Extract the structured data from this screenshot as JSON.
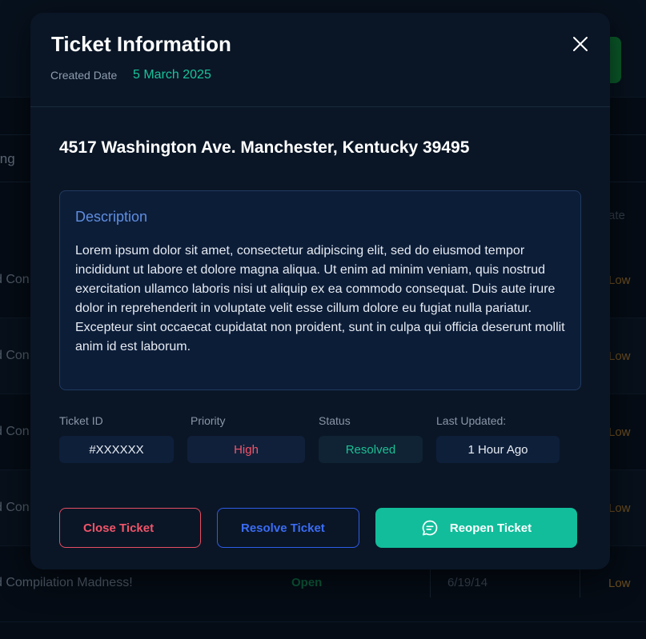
{
  "background": {
    "column_header": "ing",
    "date_header": "ate",
    "rows": [
      {
        "title": "d Con",
        "priority": "Low"
      },
      {
        "title": "d Con",
        "priority": "Low"
      },
      {
        "title": "d Con",
        "priority": "Low"
      },
      {
        "title": "d Con",
        "priority": "Low"
      },
      {
        "title": "d Compilation Madness!",
        "status": "Open",
        "date": "6/19/14",
        "priority": "Low"
      }
    ]
  },
  "modal": {
    "title": "Ticket Information",
    "created_label": "Created Date",
    "created_date": "5 March 2025",
    "close_icon": "close-icon",
    "address": "4517 Washington Ave. Manchester, Kentucky 39495",
    "description": {
      "title": "Description",
      "body": "Lorem ipsum dolor sit amet, consectetur adipiscing elit, sed do eiusmod tempor incididunt ut labore et dolore magna aliqua. Ut enim ad minim veniam, quis nostrud exercitation ullamco laboris nisi ut aliquip ex ea commodo consequat. Duis aute irure dolor in reprehenderit in voluptate velit esse cillum dolore eu fugiat nulla pariatur. Excepteur sint occaecat cupidatat non proident, sunt in culpa qui officia deserunt mollit anim id est laborum."
    },
    "fields": {
      "ticket_id_label": "Ticket ID",
      "ticket_id": "#XXXXXX",
      "priority_label": "Priority",
      "priority": "High",
      "status_label": "Status",
      "status": "Resolved",
      "updated_label": "Last Updated:",
      "updated": "1 Hour Ago"
    },
    "actions": {
      "close_label": "Close Ticket",
      "resolve_label": "Resolve Ticket",
      "reopen_label": "Reopen Ticket",
      "reopen_icon": "chat-icon"
    }
  },
  "colors": {
    "accent_green": "#12bd9b",
    "danger_red": "#f25469",
    "primary_blue": "#3b6cf5",
    "modal_bg": "#0a1626"
  }
}
